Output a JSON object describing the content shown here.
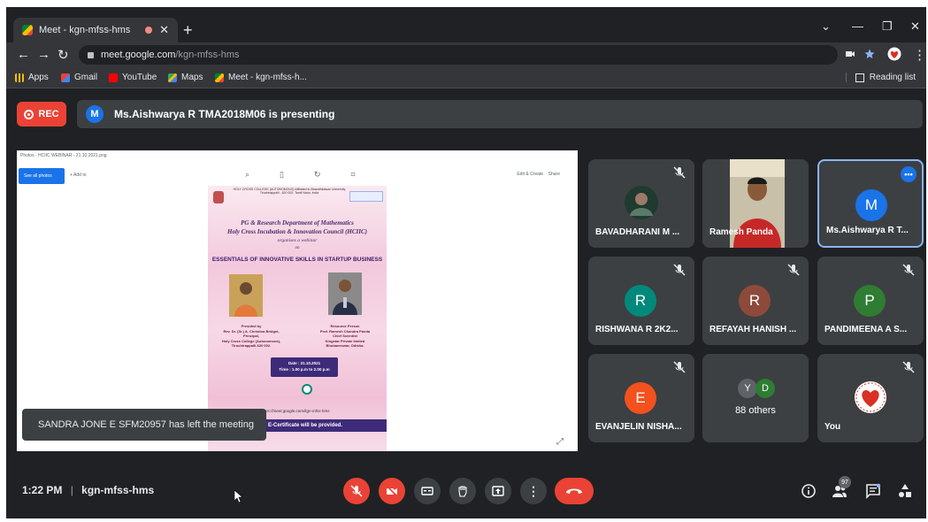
{
  "browser": {
    "tab_title": "Meet - kgn-mfss-hms",
    "url_host": "meet.google.com",
    "url_path": "/kgn-mfss-hms",
    "bookmarks": [
      {
        "label": "Apps"
      },
      {
        "label": "Gmail"
      },
      {
        "label": "YouTube"
      },
      {
        "label": "Maps"
      },
      {
        "label": "Meet - kgn-mfss-h..."
      }
    ],
    "reading_list": "Reading list"
  },
  "meet": {
    "rec_label": "REC",
    "presenter_initial": "M",
    "presenting_text": "Ms.Aishwarya R TMA2018M06 is presenting",
    "toast": "SANDRA JONE E SFM20957 has left the meeting",
    "clock": "1:22 PM",
    "meeting_code": "kgn-mfss-hms",
    "participant_count": "97"
  },
  "presentation": {
    "viewer_title": "Photos - HCIIC WEBINAR - 21.10.2021.png",
    "see_all": "See all photos",
    "add_to": "+ Add to",
    "edit_create": "Edit & Create",
    "share": "Share",
    "flyer": {
      "header": "HOLY CROSS COLLEGE (AUTONOMOUS) Affiliated to Bharathidasan University Tiruchirappalli - 620 002, Tamil Nadu, India",
      "dept": "PG & Research Department of Mathematics",
      "council": "Holy Cross Incubation & Innovation Council (HCIIC)",
      "organises": "organises a webinar",
      "on": "on",
      "topic": "ESSENTIALS OF INNOVATIVE SKILLS IN STARTUP BUSINESS",
      "presided_title": "Presided by",
      "presided_name": "Rev. Dr. (Sr.) A. Christina Bridget,",
      "presided_role": "Principal,",
      "presided_org": "Holy Cross College (Autonomous),",
      "presided_city": "Tiruchirappalli-620 002.",
      "resource_title": "Resource Person",
      "resource_name": "Prof. Ramesh Chandra Panda",
      "resource_role": "Chief Scientist",
      "resource_org": "Kingstar Private limited",
      "resource_city": "Bhubaneswar, Odisha.",
      "date": "Date : 21.10.2021",
      "time": "Time : 1.00 p.m to 2.00 p.m",
      "link": "https://meet.google.com/kgn-mfss-hms",
      "certificate": "E-Certificate will be provided."
    }
  },
  "participants": [
    {
      "name": "BAVADHARANI M ...",
      "muted": true,
      "type": "photo"
    },
    {
      "name": "Ramesh Panda",
      "muted": false,
      "type": "video"
    },
    {
      "name": "Ms.Aishwarya R T...",
      "muted": false,
      "type": "avatar",
      "initial": "M",
      "color": "#1a73e8",
      "active": true
    },
    {
      "name": "RISHWANA R 2K2...",
      "muted": true,
      "type": "avatar",
      "initial": "R",
      "color": "#00897b"
    },
    {
      "name": "REFAYAH HANISH ...",
      "muted": true,
      "type": "avatar",
      "initial": "R",
      "color": "#8d4a3a"
    },
    {
      "name": "PANDIMEENA A S...",
      "muted": true,
      "type": "avatar",
      "initial": "P",
      "color": "#2e7d32"
    },
    {
      "name": "EVANJELIN NISHA...",
      "muted": true,
      "type": "avatar",
      "initial": "E",
      "color": "#f4511e"
    },
    {
      "name": "88 others",
      "muted": false,
      "type": "others",
      "initials": [
        "Y",
        "D"
      ]
    },
    {
      "name": "You",
      "muted": true,
      "type": "logo"
    }
  ],
  "colors": {
    "accent": "#1a73e8",
    "danger": "#ea4335",
    "tile": "#3c4043",
    "background": "#202124"
  }
}
